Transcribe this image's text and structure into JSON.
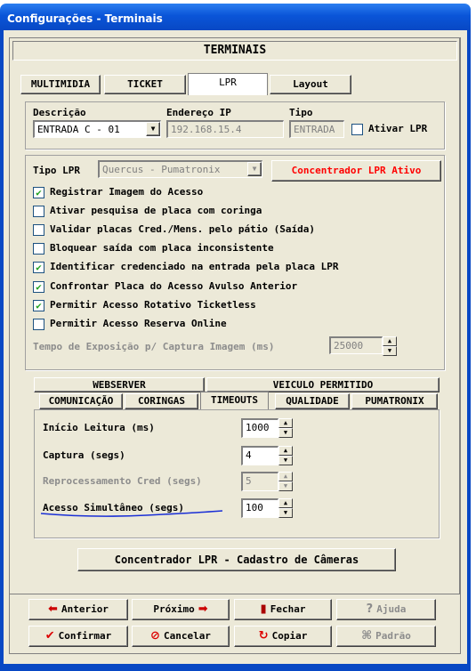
{
  "window": {
    "title": "Configurações - Terminais"
  },
  "header": {
    "title": "TERMINAIS"
  },
  "main_tabs": {
    "multimidia": "MULTIMIDIA",
    "ticket": "TICKET",
    "lpr": "LPR",
    "layout": "Layout"
  },
  "terminal": {
    "descricao_label": "Descrição",
    "descricao_value": "ENTRADA C - 01",
    "endereco_label": "Endereço IP",
    "endereco_value": "192.168.15.4",
    "tipo_label": "Tipo",
    "tipo_value": "ENTRADA",
    "ativar_label": "Ativar LPR",
    "ativar_checked": false
  },
  "lpr": {
    "tipo_label": "Tipo LPR",
    "tipo_value": "Quercus - Pumatronix",
    "concentrador_button": "Concentrador LPR Ativo",
    "options": [
      {
        "label": "Registrar Imagem do Acesso",
        "checked": true
      },
      {
        "label": "Ativar pesquisa de placa com coringa",
        "checked": false
      },
      {
        "label": "Validar placas Cred./Mens. pelo pátio (Saída)",
        "checked": false
      },
      {
        "label": "Bloquear saída com placa inconsistente",
        "checked": false
      },
      {
        "label": "Identificar credenciado na entrada pela placa LPR",
        "checked": true
      },
      {
        "label": "Confrontar Placa do Acesso Avulso Anterior",
        "checked": true
      },
      {
        "label": "Permitir Acesso Rotativo Ticketless",
        "checked": true
      },
      {
        "label": "Permitir Acesso Reserva Online",
        "checked": false
      }
    ],
    "exposicao_label": "Tempo de Exposição p/ Captura Imagem (ms)",
    "exposicao_value": "25000"
  },
  "sub_tabs": {
    "row1": [
      "WEBSERVER",
      "VEICULO PERMITIDO"
    ],
    "row2": [
      "COMUNICAÇÃO",
      "CORINGAS",
      "TIMEOUTS",
      "QUALIDADE",
      "PUMATRONIX"
    ]
  },
  "timeouts": [
    {
      "label": "Início Leitura (ms)",
      "value": "1000",
      "disabled": false
    },
    {
      "label": "Captura (segs)",
      "value": "4",
      "disabled": false
    },
    {
      "label": "Reprocessamento Cred (segs)",
      "value": "5",
      "disabled": true
    },
    {
      "label": "Acesso Simultâneo (segs)",
      "value": "100",
      "disabled": false
    }
  ],
  "cadastro_button": "Concentrador LPR - Cadastro de Câmeras",
  "footer": {
    "anterior": "Anterior",
    "proximo": "Próximo",
    "fechar": "Fechar",
    "ajuda": "Ajuda",
    "confirmar": "Confirmar",
    "cancelar": "Cancelar",
    "copiar": "Copiar",
    "padrao": "Padrão"
  },
  "colors": {
    "titlebar": "#0a55d8",
    "alert_text": "#ff0000",
    "check": "#21a121",
    "annotation": "#1a2fd6"
  }
}
